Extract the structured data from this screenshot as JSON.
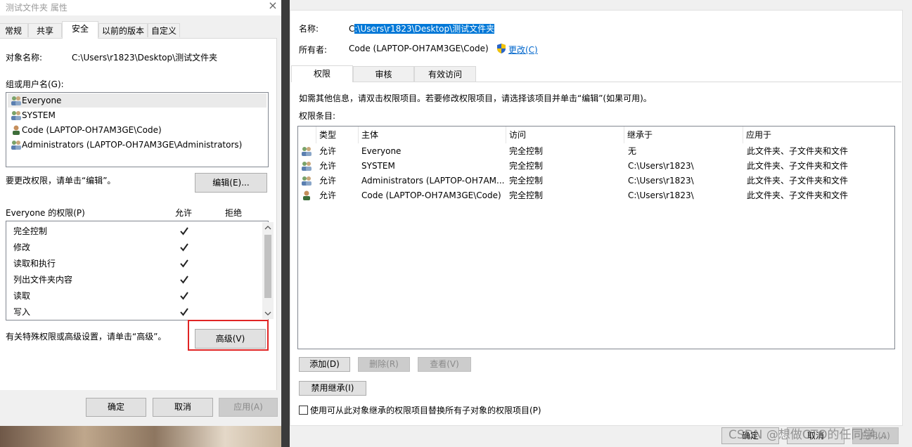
{
  "left": {
    "title": "测试文件夹 属性",
    "close": "×",
    "tabs": [
      "常规",
      "共享",
      "安全",
      "以前的版本",
      "自定义"
    ],
    "active_tab": "安全",
    "object_label": "对象名称:",
    "object_value": "C:\\Users\\r1823\\Desktop\\测试文件夹",
    "group_label": "组或用户名(G):",
    "users": [
      "Everyone",
      "SYSTEM",
      "Code (LAPTOP-OH7AM3GE\\Code)",
      "Administrators (LAPTOP-OH7AM3GE\\Administrators)"
    ],
    "change_hint": "要更改权限，请单击“编辑”。",
    "edit_button": "编辑(E)...",
    "perm_header": "Everyone 的权限(P)",
    "allow_label": "允许",
    "deny_label": "拒绝",
    "permissions": [
      {
        "name": "完全控制",
        "allow": true,
        "deny": false
      },
      {
        "name": "修改",
        "allow": true,
        "deny": false
      },
      {
        "name": "读取和执行",
        "allow": true,
        "deny": false
      },
      {
        "name": "列出文件夹内容",
        "allow": true,
        "deny": false
      },
      {
        "name": "读取",
        "allow": true,
        "deny": false
      },
      {
        "name": "写入",
        "allow": true,
        "deny": false
      }
    ],
    "advanced_hint": "有关特殊权限或高级设置，请单击“高级”。",
    "advanced_button": "高级(V)",
    "ok": "确定",
    "cancel": "取消",
    "apply": "应用(A)"
  },
  "right": {
    "name_label": "名称:",
    "name_prefix": "C",
    "name_selected": ":\\Users\\r1823\\Desktop\\测试文件夹",
    "owner_label": "所有者:",
    "owner_value": "Code (LAPTOP-OH7AM3GE\\Code)",
    "owner_change": "更改(C)",
    "tabs": [
      "权限",
      "审核",
      "有效访问"
    ],
    "active_tab": "权限",
    "info": "如需其他信息，请双击权限项目。若要修改权限项目，请选择该项目并单击“编辑”(如果可用)。",
    "entries_label": "权限条目:",
    "columns": [
      "类型",
      "主体",
      "访问",
      "继承于",
      "应用于"
    ],
    "rows": [
      {
        "type": "允许",
        "principal": "Everyone",
        "access": "完全控制",
        "inherited": "无",
        "applies": "此文件夹、子文件夹和文件"
      },
      {
        "type": "允许",
        "principal": "SYSTEM",
        "access": "完全控制",
        "inherited": "C:\\Users\\r1823\\",
        "applies": "此文件夹、子文件夹和文件"
      },
      {
        "type": "允许",
        "principal": "Administrators (LAPTOP-OH7AM...",
        "access": "完全控制",
        "inherited": "C:\\Users\\r1823\\",
        "applies": "此文件夹、子文件夹和文件"
      },
      {
        "type": "允许",
        "principal": "Code (LAPTOP-OH7AM3GE\\Code)",
        "access": "完全控制",
        "inherited": "C:\\Users\\r1823\\",
        "applies": "此文件夹、子文件夹和文件"
      }
    ],
    "add": "添加(D)",
    "remove": "删除(R)",
    "view": "查看(V)",
    "disable_inherit": "禁用继承(I)",
    "replace_label": "使用可从此对象继承的权限项目替换所有子对象的权限项目(P)",
    "ok": "确定",
    "cancel": "取消",
    "apply": "应用(A)"
  },
  "watermark": "CSDN @想做CTO的任同学..."
}
